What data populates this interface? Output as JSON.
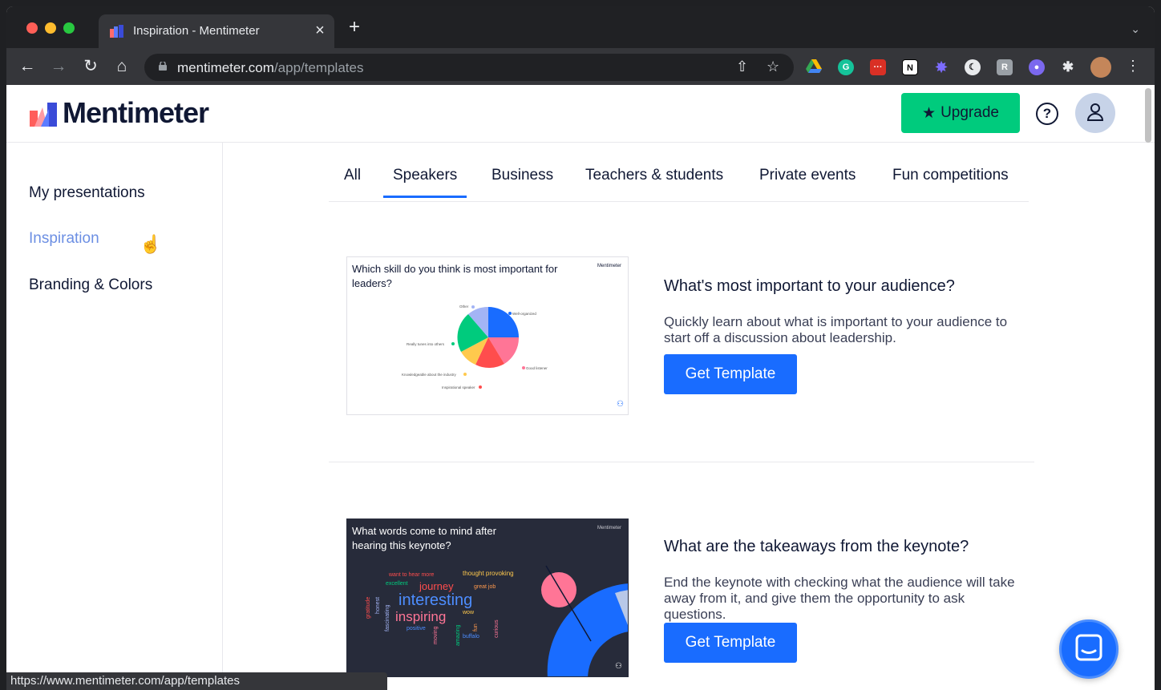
{
  "browser": {
    "tab_title": "Inspiration - Mentimeter",
    "tab_close": "×",
    "new_tab": "+",
    "url_host": "mentimeter.com",
    "url_path": "/app/templates",
    "status_url": "https://www.mentimeter.com/app/templates",
    "traffic_colors": [
      "#ff5f57",
      "#febc2e",
      "#28c840"
    ]
  },
  "app": {
    "brand": "Mentimeter",
    "upgrade_label": "Upgrade",
    "help_symbol": "?"
  },
  "sidebar": {
    "items": [
      {
        "label": "My presentations"
      },
      {
        "label": "Inspiration"
      },
      {
        "label": "Branding & Colors"
      }
    ]
  },
  "categories": [
    "All",
    "Speakers",
    "Business",
    "Teachers & students",
    "Private events",
    "Fun competitions"
  ],
  "templates": [
    {
      "thumb_title": "Which skill do you think is most important for leaders?",
      "thumb_brand": "Mentimeter",
      "title": "What's most important to your audience?",
      "description": "Quickly learn about what is important to your audience to start off a discussion about leadership.",
      "button": "Get Template",
      "pie_labels": [
        "Other",
        "Well-organized",
        "Really tunes into others",
        "Good listener",
        "Knowledgeable about the industry",
        "Inspirational speaker"
      ]
    },
    {
      "thumb_title": "What words come to mind after hearing this keynote?",
      "thumb_brand": "Mentimeter",
      "title": "What are the takeaways from the keynote?",
      "description": "End the keynote with checking what the audience will take away from it, and give them the opportunity to ask questions.",
      "button": "Get Template",
      "words": [
        "want to hear more",
        "thought provoking",
        "excellent",
        "journey",
        "great job",
        "interesting",
        "inspiring",
        "wow",
        "positive",
        "buffalo",
        "amazing",
        "fun",
        "fascinating",
        "honest",
        "gratitude",
        "moving",
        "curious"
      ]
    }
  ]
}
